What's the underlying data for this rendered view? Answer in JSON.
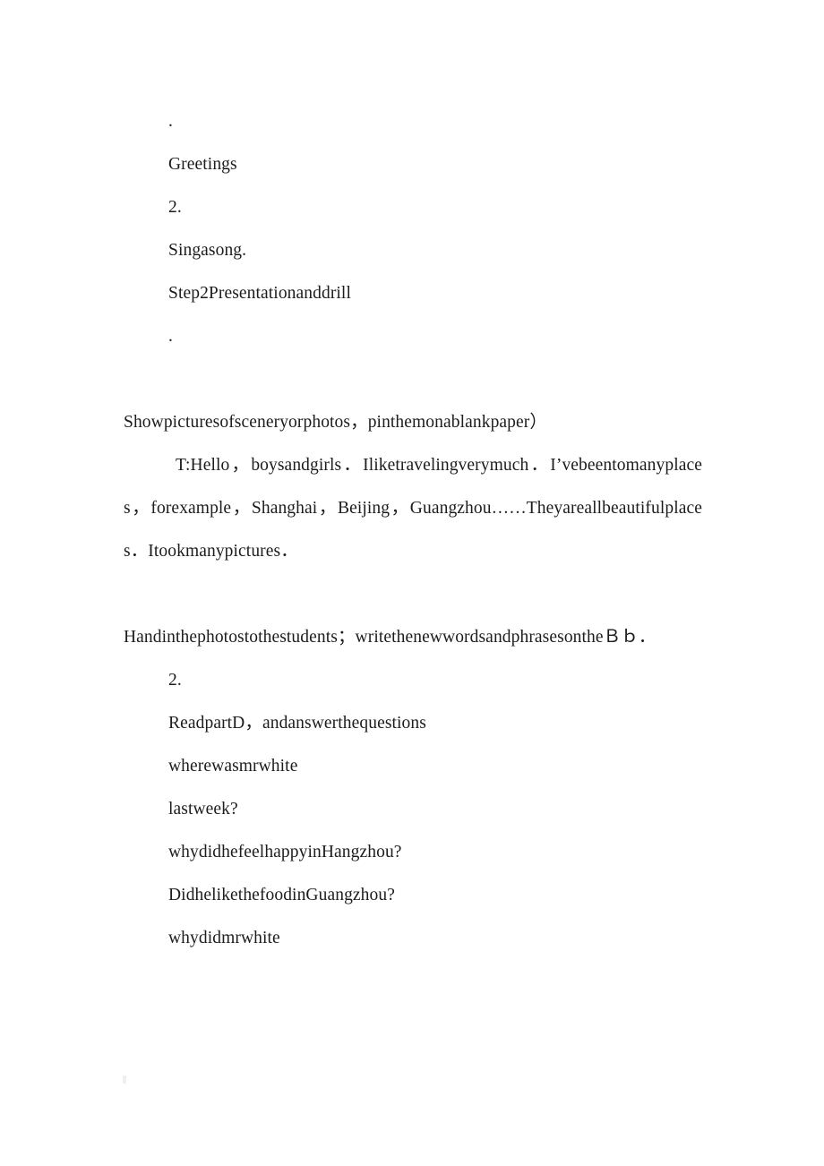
{
  "document": {
    "background_color": "#ffffff",
    "text_color": "#1c1c1c",
    "blocks": {
      "bullet_1": ".",
      "greetings": "Greetings",
      "item_2": "2.",
      "sing_a_song": "Singasong.",
      "step_2_heading": "Step2Presentationanddrill",
      "bullet_2": ".",
      "show_pictures": "Showpicturesofsceneryorphotos，pinthemonablankpaper）",
      "teacher_speech": "T:Hello，boysandgirls．Iliketravelingverymuch．I’vebeentomanyplaces，forexample，Shanghai，Beijing，Guangzhou……Theyareallbeautifulplaces．Itookmanypictures．",
      "hand_in_photos": "Handinthephotostothestudents；writethenewwordsandphrasesontheＢｂ．",
      "item_2b": "2.",
      "read_part_d": "ReadpartD，andanswerthequestions",
      "question_1a": "wherewasmrwhite",
      "question_1b": "lastweek?",
      "question_2": "whydidhefeelhappyinHangzhou?",
      "question_3": "DidhelikethefoodinGuangzhou?",
      "question_4": "whydidmrwhite"
    }
  }
}
